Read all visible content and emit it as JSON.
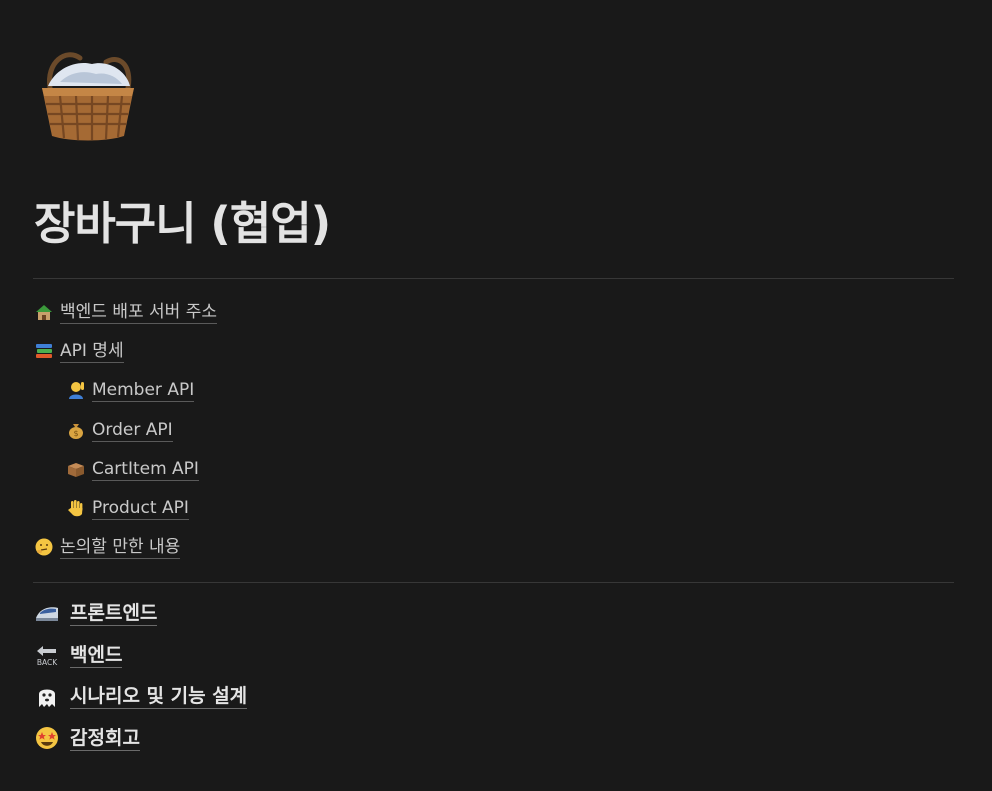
{
  "page": {
    "icon": "basket-icon",
    "title": "장바구니 (협업)"
  },
  "links": [
    {
      "icon": "hut-icon",
      "label": "백엔드 배포 서버 주소"
    },
    {
      "icon": "books-icon",
      "label": "API 명세"
    },
    {
      "icon": "person-raising-hand-icon",
      "label": "Member API"
    },
    {
      "icon": "money-bag-icon",
      "label": "Order API"
    },
    {
      "icon": "box-icon",
      "label": "CartItem API"
    },
    {
      "icon": "raised-hand-icon",
      "label": "Product API"
    },
    {
      "icon": "thinking-face-icon",
      "label": "논의할 만한 내용"
    }
  ],
  "sections": [
    {
      "icon": "bullet-train-icon",
      "label": "프론트엔드"
    },
    {
      "icon": "back-arrow-icon",
      "icon_text": "BACK",
      "label": "백엔드"
    },
    {
      "icon": "ghost-icon",
      "label": "시나리오 및 기능 설계"
    },
    {
      "icon": "star-struck-icon",
      "label": "감정회고"
    }
  ]
}
